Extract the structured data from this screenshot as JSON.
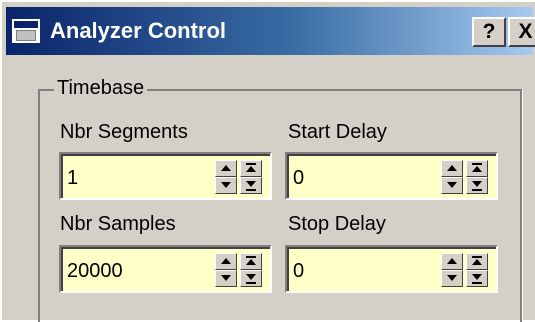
{
  "window": {
    "title": "Analyzer Control",
    "help_label": "?",
    "close_label": "X"
  },
  "timebase": {
    "legend": "Timebase",
    "nbr_segments": {
      "label": "Nbr Segments",
      "value": "1"
    },
    "start_delay": {
      "label": "Start Delay",
      "value": "0"
    },
    "nbr_samples": {
      "label": "Nbr Samples",
      "value": "20000"
    },
    "stop_delay": {
      "label": "Stop Delay",
      "value": "0"
    }
  },
  "icons": [
    "window-icon",
    "step-up-icon",
    "step-down-icon",
    "fast-up-icon",
    "fast-down-icon"
  ],
  "colors": {
    "titlebar_start": "#0a246a",
    "field_background": "#ffffc8",
    "window_face": "#d4d0c8"
  }
}
